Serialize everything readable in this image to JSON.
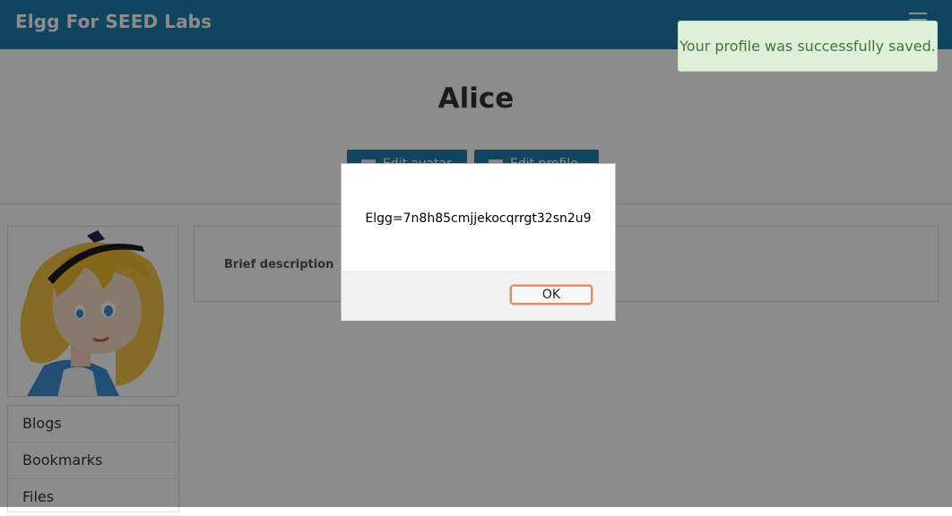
{
  "header": {
    "site_title": "Elgg For SEED Labs",
    "menu_icon": "hamburger-menu-icon"
  },
  "profile": {
    "name": "Alice",
    "edit_avatar_label": "Edit avatar",
    "edit_profile_label": "Edit profile",
    "brief_description_label": "Brief description"
  },
  "owner_menu": {
    "items": [
      "Blogs",
      "Bookmarks",
      "Files"
    ]
  },
  "notification": {
    "message": "Your profile was successfully saved."
  },
  "alert": {
    "message": "Elgg=7n8h85cmjjekocqrrgt32sn2u9",
    "ok_label": "OK"
  },
  "colors": {
    "topbar": "#1f7cac",
    "success_bg": "#dff0d8",
    "success_text": "#3c763d"
  }
}
